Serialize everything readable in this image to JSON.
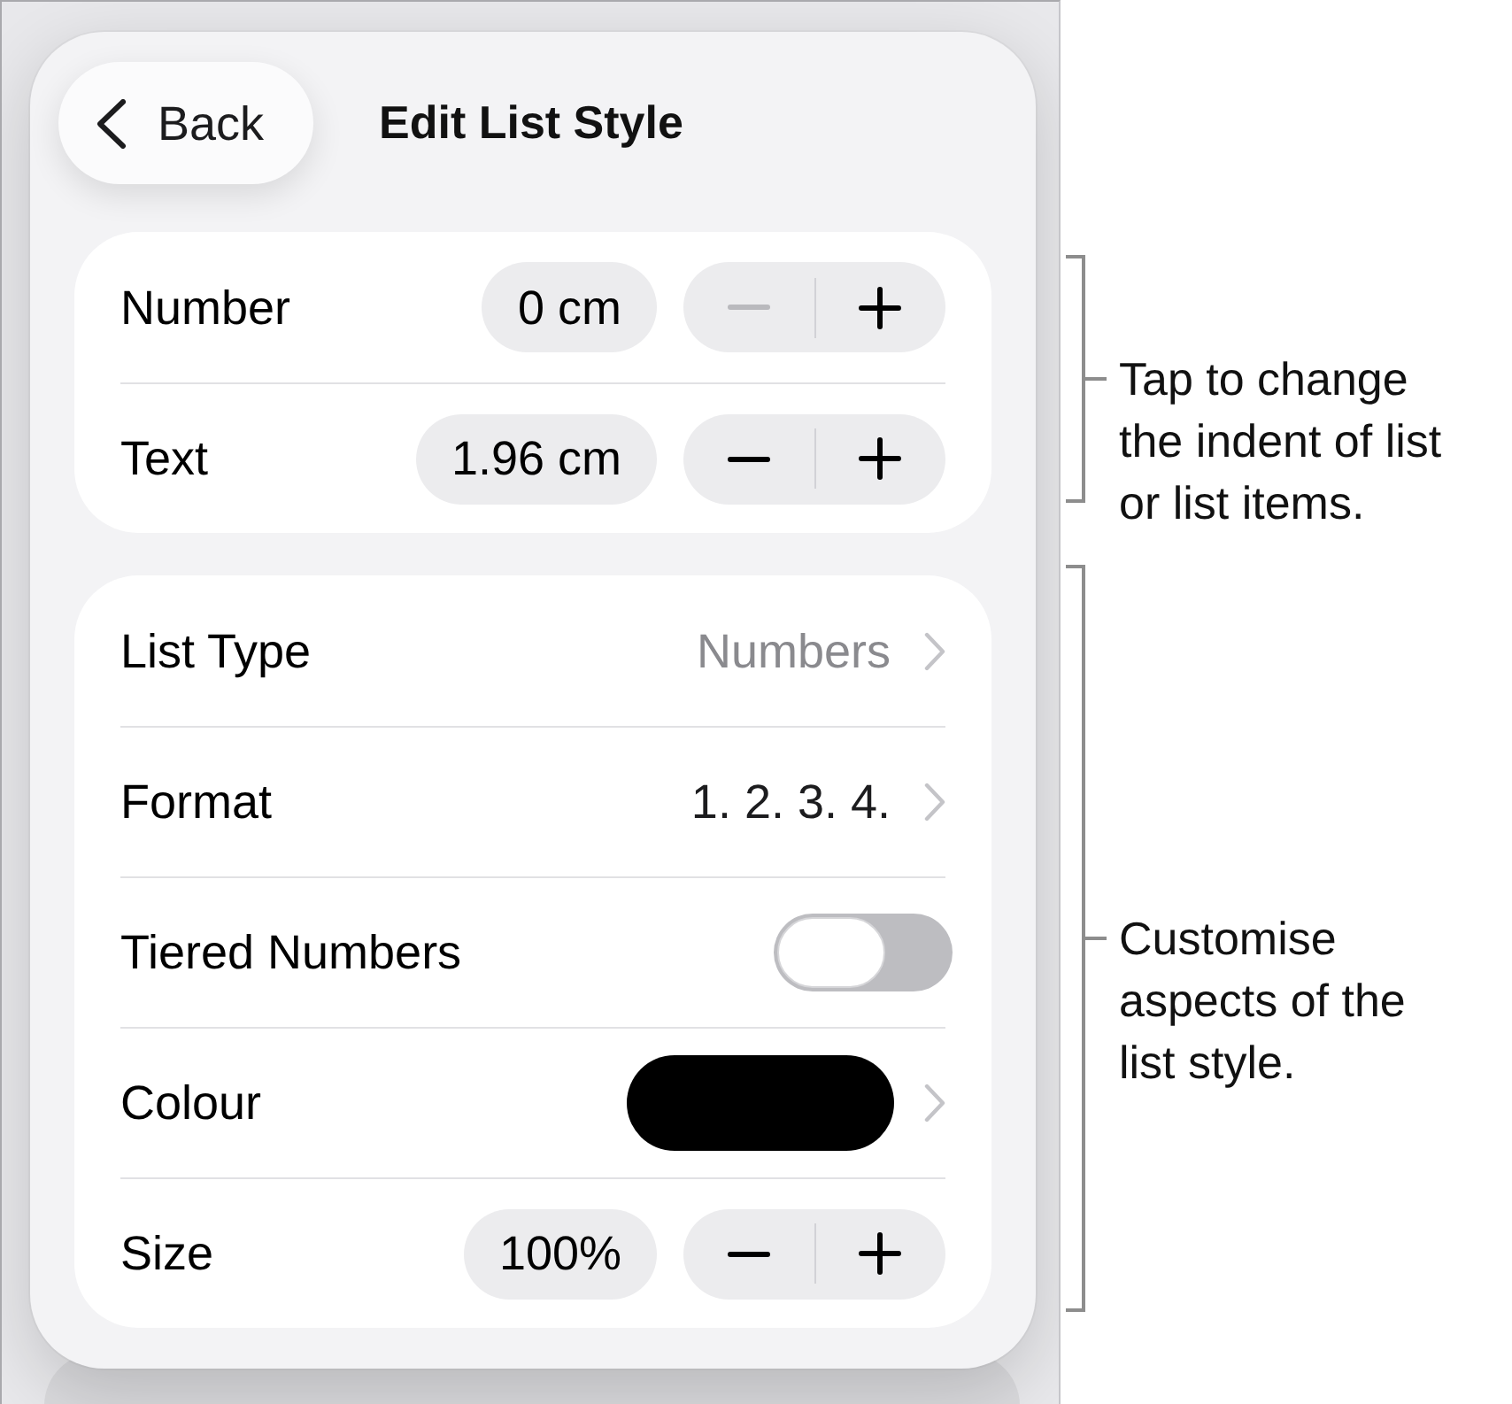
{
  "popover": {
    "back_button": {
      "label": "Back"
    },
    "title": "Edit List Style",
    "indent_card": {
      "rows": [
        {
          "kind": "stepper",
          "label": "Number",
          "value": "0 cm",
          "decrease_disabled": true,
          "increase_disabled": false
        },
        {
          "kind": "stepper",
          "label": "Text",
          "value": "1.96 cm",
          "decrease_disabled": false,
          "increase_disabled": false
        }
      ]
    },
    "style_card": {
      "rows": [
        {
          "kind": "picker",
          "label": "List Type",
          "value": "Numbers",
          "value_dimmed": true
        },
        {
          "kind": "picker",
          "label": "Format",
          "value": "1. 2. 3. 4.",
          "value_dimmed": false
        },
        {
          "kind": "toggle",
          "label": "Tiered Numbers",
          "on": false
        },
        {
          "kind": "color",
          "label": "Colour",
          "color": "#000000"
        },
        {
          "kind": "stepper",
          "label": "Size",
          "value": "100%",
          "decrease_disabled": false,
          "increase_disabled": false
        }
      ]
    }
  },
  "callouts": [
    {
      "text": "Tap to change the indent of list or list items."
    },
    {
      "text": "Customise aspects of the list style."
    }
  ]
}
